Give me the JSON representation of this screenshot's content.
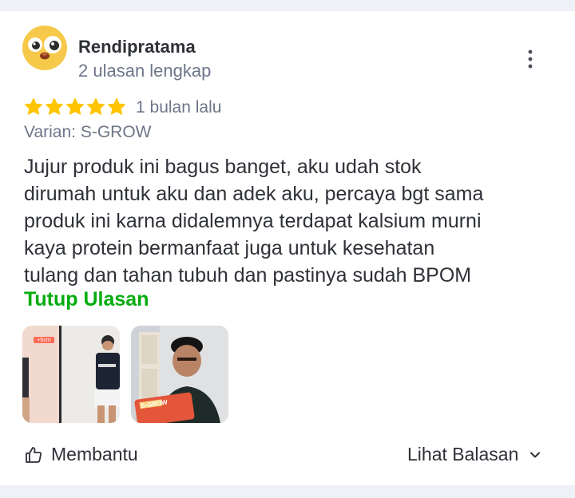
{
  "review": {
    "user": {
      "name": "Rendipratama",
      "review_count": "2 ulasan lengkap",
      "avatar_icon": "cartoon-face-avatar"
    },
    "rating": 5,
    "time": "1 bulan lalu",
    "variant": "Varian: S-GROW",
    "text_lines": [
      "Jujur produk ini bagus banget, aku udah stok",
      "dirumah untuk aku dan adek aku, percaya bgt sama",
      "produk ini karna didalemnya terdapat kalsium murni",
      "kaya protein bermanfaat juga untuk kesehatan",
      "tulang dan tahan tubuh dan pastinya sudah BPOM"
    ],
    "toggle_label": "Tutup Ulasan",
    "photos": [
      {
        "caption": "+5cm"
      },
      {
        "caption": "S-GROW"
      }
    ],
    "actions": {
      "helpful_label": "Membantu",
      "replies_label": "Lihat Balasan"
    }
  },
  "colors": {
    "accent_green": "#03ac0e",
    "star": "#ffc400",
    "text": "#2e3137",
    "muted": "#6d7588",
    "band": "#eef1f6"
  },
  "icons": [
    "more-vertical-icon",
    "star-icon",
    "thumbs-up-icon",
    "chevron-down-icon"
  ]
}
